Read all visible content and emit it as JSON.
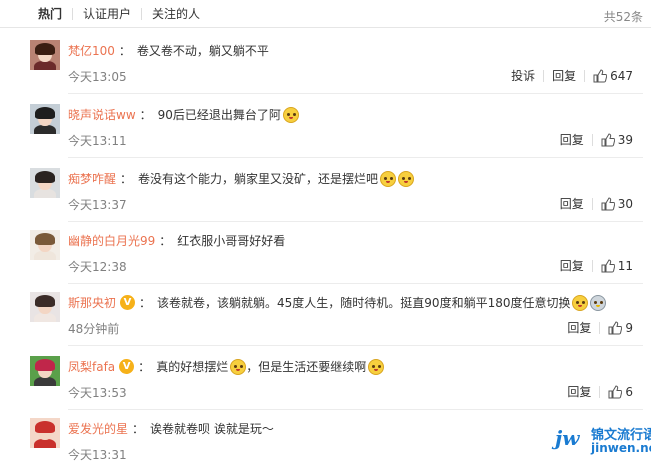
{
  "tabs": [
    {
      "label": "热门"
    },
    {
      "label": "认证用户"
    },
    {
      "label": "关注的人"
    }
  ],
  "total_count": "共52条",
  "comments": [
    {
      "user": "梵亿100",
      "text": "卷又卷不动，躺又躺不平",
      "emojis": [],
      "time": "今天13:05",
      "report": "投诉",
      "reply": "回复",
      "likes": "647",
      "verified": false,
      "avatar": {
        "hair": "#3a1d12",
        "body": "#6b2a2a",
        "bg": "#b98273"
      }
    },
    {
      "user": "晓声说话ww",
      "text": "90后已经退出舞台了阿",
      "emojis": [
        "emoji-face"
      ],
      "time": "今天13:11",
      "report": "",
      "reply": "回复",
      "likes": "39",
      "verified": false,
      "avatar": {
        "hair": "#1e1e1e",
        "body": "#2b2b2b",
        "bg": "#c4ced6"
      }
    },
    {
      "user": "痴梦咋醒",
      "text": "卷没有这个能力，躺家里又没矿，还是摆烂吧",
      "emojis": [
        "emoji-face",
        "emoji-face"
      ],
      "time": "今天13:37",
      "report": "",
      "reply": "回复",
      "likes": "30",
      "verified": false,
      "avatar": {
        "hair": "#2a2320",
        "body": "#e7e3e0",
        "bg": "#d9dde0"
      }
    },
    {
      "user": "幽静的白月光99",
      "text": "红衣服小哥哥好好看",
      "emojis": [],
      "time": "今天12:38",
      "report": "",
      "reply": "回复",
      "likes": "11",
      "verified": false,
      "avatar": {
        "hair": "#7a5a3a",
        "body": "#efe6dc",
        "bg": "#f2ede6"
      }
    },
    {
      "user": "斯那央初",
      "text": "该卷就卷，该躺就躺。45度人生，随时待机。挺直90度和躺平180度任意切换",
      "emojis": [
        "emoji-face",
        "emoji-robot"
      ],
      "time": "48分钟前",
      "report": "",
      "reply": "回复",
      "likes": "9",
      "verified": true,
      "avatar": {
        "hair": "#3b2c28",
        "body": "#f0e7e2",
        "bg": "#e9e4e4"
      }
    },
    {
      "user": "凤梨fafa",
      "text": "真的好想摆烂",
      "text2": "，但是生活还要继续啊",
      "emojis": [
        "emoji-face"
      ],
      "emojis2": [
        "emoji-face"
      ],
      "time": "今天13:53",
      "report": "",
      "reply": "回复",
      "likes": "6",
      "verified": true,
      "avatar": {
        "hair": "#c0264a",
        "body": "#3a3a3a",
        "bg": "#5aa04a"
      }
    },
    {
      "user": "爱发光的星",
      "text": "诶卷就卷呗 诶就是玩～",
      "emojis": [],
      "time": "今天13:31",
      "report": "",
      "reply": "",
      "likes": "",
      "verified": false,
      "avatar": {
        "hair": "#c9302c",
        "body": "#c9302c",
        "bg": "#f4d7c8"
      }
    }
  ],
  "verified_badge": "V",
  "watermark": {
    "logo": "jw",
    "line1": "锦文流行语",
    "line2": "jinwen.net"
  },
  "colors": {
    "username": "#eb7350",
    "time": "#808080",
    "badge": "#f6b119",
    "watermark": "#1a7bd1"
  }
}
